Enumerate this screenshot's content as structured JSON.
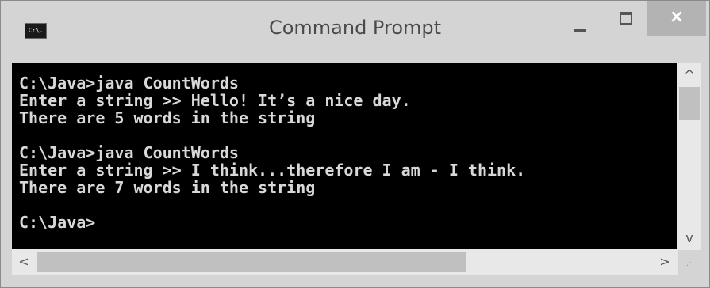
{
  "window": {
    "title": "Command Prompt",
    "icon_label": "C:\\.",
    "buttons": {
      "minimize": "minimize",
      "maximize": "maximize",
      "close": "×"
    }
  },
  "console": {
    "lines": [
      "C:\\Java>java CountWords",
      "Enter a string >> Hello! It’s a nice day.",
      "There are 5 words in the string",
      "",
      "C:\\Java>java CountWords",
      "Enter a string >> I think...therefore I am - I think.",
      "There are 7 words in the string",
      "",
      "C:\\Java>"
    ]
  },
  "scrollbars": {
    "up_arrow": "^",
    "down_arrow": "v",
    "left_arrow": "<",
    "right_arrow": ">",
    "vertical_position": 0.0,
    "horizontal_position": 0.0
  },
  "colors": {
    "console_bg": "#000000",
    "console_text": "#d8d8d8",
    "titlebar_bg": "#d4d4d4",
    "close_button_bg": "#b3b3b3"
  },
  "icons": [
    "console-app-icon",
    "minimize-icon",
    "maximize-icon",
    "close-icon",
    "scroll-up-icon",
    "scroll-down-icon",
    "scroll-left-icon",
    "scroll-right-icon",
    "resize-grip-icon"
  ]
}
